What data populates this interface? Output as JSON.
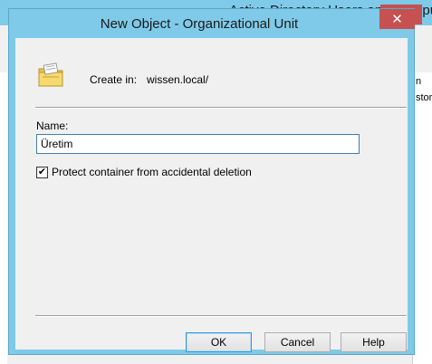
{
  "background_window": {
    "title": "Active Directory Users and Compu",
    "column_fragments": [
      "n",
      "stor"
    ]
  },
  "dialog": {
    "title": "New Object - Organizational Unit",
    "close_glyph": "✕",
    "create_in_label": "Create in:",
    "create_in_value": "wissen.local/",
    "name_label": "Name:",
    "name_value": "Üretim",
    "protect_checkbox": {
      "label": "Protect container from accidental deletion",
      "checked": true,
      "check_glyph": "✔"
    },
    "buttons": {
      "ok": "OK",
      "cancel": "Cancel",
      "help": "Help"
    }
  },
  "colors": {
    "titlebar": "#7fcae9",
    "close_button": "#c75050",
    "dialog_body": "#f0f0f0",
    "input_border": "#3c7fb1",
    "default_button_border": "#3399dd"
  },
  "icons": {
    "object": "organizational-unit-folder-icon"
  }
}
